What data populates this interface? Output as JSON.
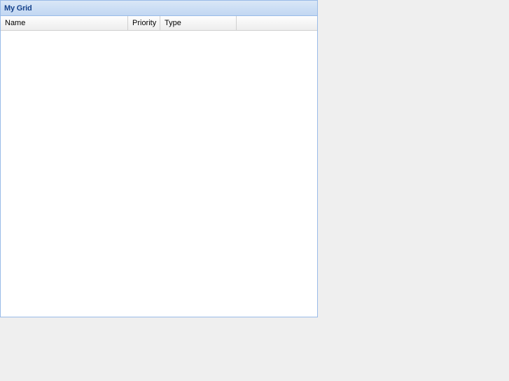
{
  "panel": {
    "title": "My Grid"
  },
  "grid": {
    "columns": [
      {
        "label": "Name"
      },
      {
        "label": "Priority"
      },
      {
        "label": "Type"
      }
    ],
    "rows": []
  },
  "colors": {
    "panel_border": "#99bbe8",
    "title_text": "#15428b",
    "page_background": "#efefef"
  }
}
